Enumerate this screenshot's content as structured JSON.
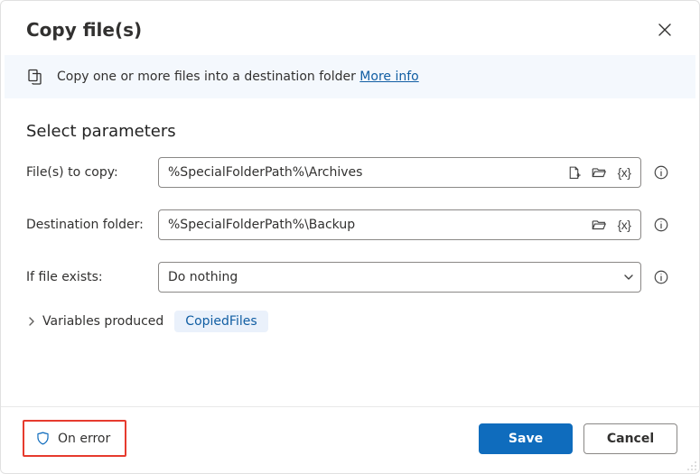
{
  "header": {
    "title": "Copy file(s)"
  },
  "banner": {
    "text": "Copy one or more files into a destination folder ",
    "link": "More info"
  },
  "section_title": "Select parameters",
  "labels": {
    "files_to_copy": "File(s) to copy:",
    "destination_folder": "Destination folder:",
    "if_file_exists": "If file exists:",
    "variables_produced": "Variables produced"
  },
  "fields": {
    "files_to_copy_value": "%SpecialFolderPath%\\Archives",
    "destination_folder_value": "%SpecialFolderPath%\\Backup",
    "if_file_exists_value": "Do nothing"
  },
  "variables_produced_chip": "CopiedFiles",
  "footer": {
    "on_error": "On error",
    "save": "Save",
    "cancel": "Cancel"
  },
  "tokens": {
    "var_brace": "{x}"
  }
}
